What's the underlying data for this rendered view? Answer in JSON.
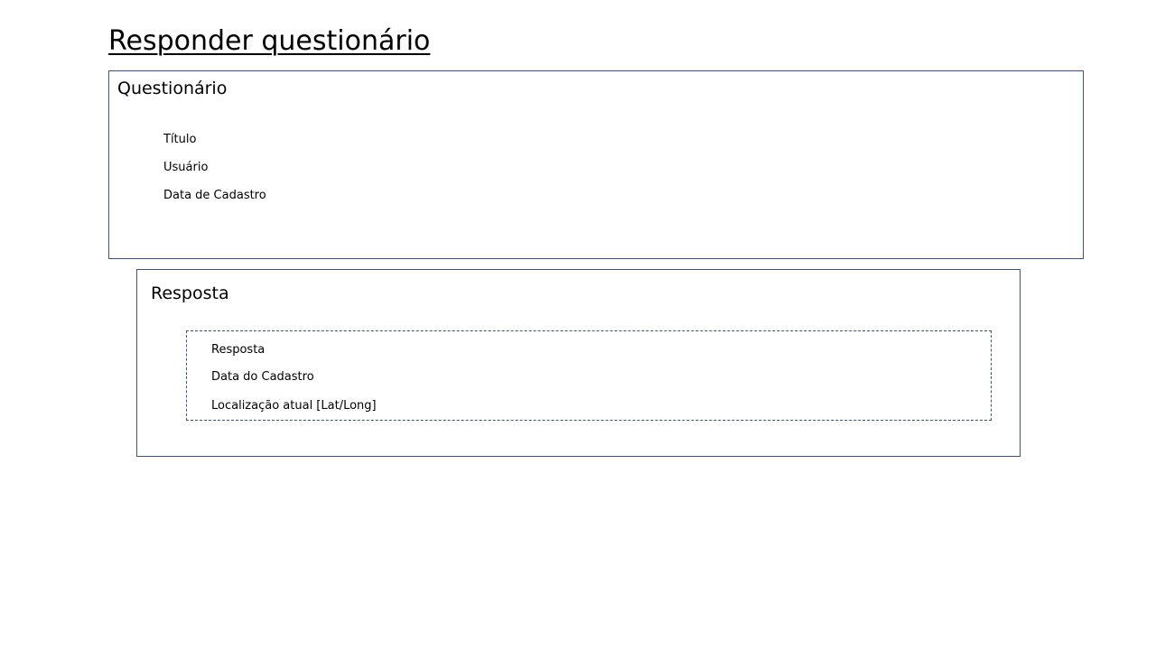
{
  "page": {
    "title": "Responder questionário"
  },
  "questionario": {
    "heading": "Questionário",
    "fields": [
      "Título",
      "Usuário",
      "Data de Cadastro"
    ]
  },
  "resposta": {
    "heading": "Resposta",
    "fields": [
      "Resposta",
      "Data do Cadastro",
      "Localização atual [Lat/Long]"
    ]
  },
  "colors": {
    "border": "#41546b",
    "background": "#ffffff",
    "text": "#000000"
  }
}
